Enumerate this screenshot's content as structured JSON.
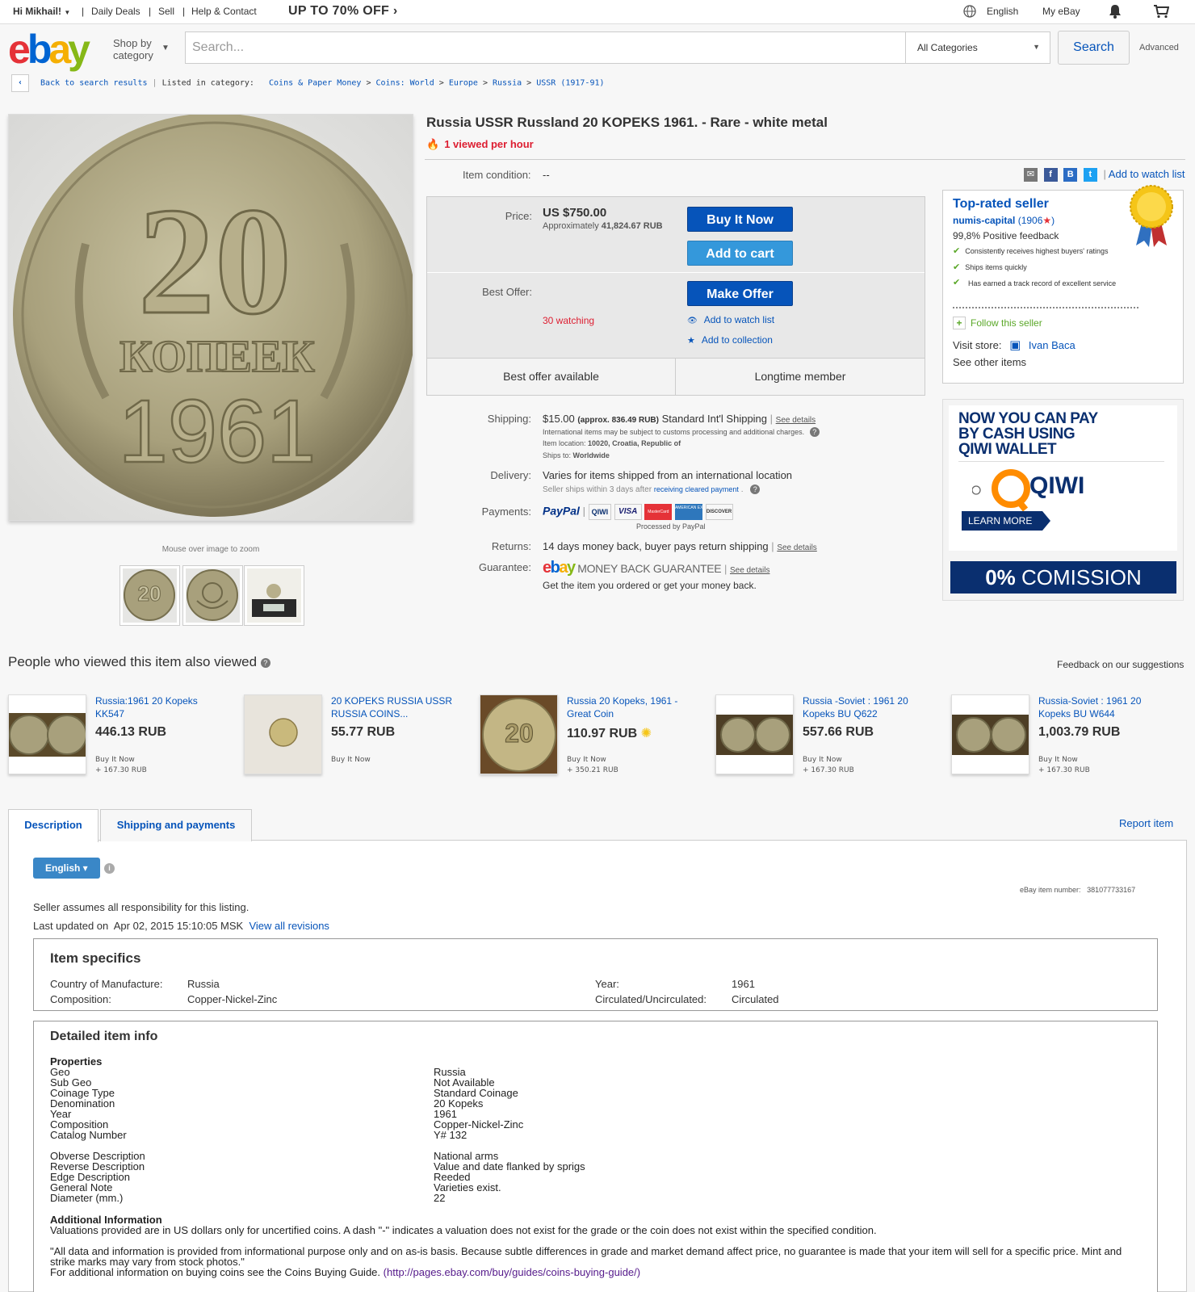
{
  "topbar": {
    "greeting": "Hi Mikhail!",
    "daily_deals": "Daily Deals",
    "sell": "Sell",
    "help": "Help & Contact",
    "promo": "UP TO 70% OFF ›",
    "language": "English",
    "my_ebay": "My eBay"
  },
  "header": {
    "logo": [
      "e",
      "b",
      "a",
      "y"
    ],
    "shop_by_1": "Shop by",
    "shop_by_2": "category",
    "search_placeholder": "Search...",
    "category": "All Categories",
    "search_button": "Search",
    "advanced": "Advanced"
  },
  "breadcrumb": {
    "back": "Back to search results",
    "listed": "Listed in category:",
    "items": [
      "Coins & Paper Money",
      "Coins: World",
      "Europe",
      "Russia",
      "USSR (1917-91)"
    ]
  },
  "gallery": {
    "zoom_note": "Mouse over image to zoom",
    "coin_value": "20",
    "coin_word": "КОПЕЕК",
    "coin_year": "1961"
  },
  "item": {
    "title": "Russia USSR Russland 20 KOPEKS 1961. - Rare - white metal",
    "viewed": "1 viewed per hour",
    "condition_label": "Item condition:",
    "condition_value": "--",
    "add_watch": "Add to watch list",
    "share_b": "B"
  },
  "buybox": {
    "price_label": "Price:",
    "price": "US $750.00",
    "approx_prefix": "Approximately",
    "approx_value": "41,824.67 RUB",
    "buy_now": "Buy It Now",
    "add_to_cart": "Add to cart",
    "best_offer_label": "Best Offer:",
    "make_offer": "Make Offer",
    "watching": "30 watching",
    "add_watch": "Add to watch list",
    "add_collection": "Add to collection",
    "best_offer_available": "Best offer available",
    "longtime_member": "Longtime member"
  },
  "seller": {
    "badge": "Top-rated seller",
    "name": "numis-capital",
    "score": "(1906",
    "score_end": ")",
    "positive": "99,8% Positive feedback",
    "checks": [
      "Consistently receives highest buyers' ratings",
      "Ships items quickly",
      "Has earned a track record of excellent service"
    ],
    "follow": "Follow this seller",
    "visit_store": "Visit store:",
    "store_name": "Ivan Baca",
    "see_other": "See other items"
  },
  "qiwi_ad": {
    "line1": "NOW YOU CAN PAY",
    "line2": "BY CASH USING",
    "line3": "QIWI WALLET",
    "brand": "QIWI",
    "learn_more": "LEARN MORE",
    "commission_pct": "0%",
    "commission_word": "COMISSION"
  },
  "details": {
    "shipping_label": "Shipping:",
    "shipping_price": "$15.00",
    "shipping_approx": "(approx. 836.49 RUB)",
    "shipping_service": "Standard Int'l Shipping",
    "see_details": "See details",
    "intl_note": "International items may be subject to customs processing and additional charges.",
    "item_location_label": "Item location:",
    "item_location": "10020, Croatia, Republic of",
    "ships_to_label": "Ships to:",
    "ships_to": "Worldwide",
    "delivery_label": "Delivery:",
    "delivery": "Varies for items shipped from an international location",
    "delivery_note_1": "Seller ships within 3 days after",
    "delivery_note_link": "receiving cleared payment",
    "payments_label": "Payments:",
    "paypal": "PayPal",
    "processed_by": "Processed by PayPal",
    "card_labels": [
      "QIWI",
      "VISA",
      "MasterCard",
      "AMERICAN EXPRESS",
      "DISCOVER"
    ],
    "returns_label": "Returns:",
    "returns": "14 days money back, buyer pays return shipping",
    "guarantee_label": "Guarantee:",
    "guarantee_text": "MONEY BACK GUARANTEE",
    "guarantee_note": "Get the item you ordered or get your money back."
  },
  "also_viewed": {
    "title": "People who viewed this item also viewed",
    "feedback": "Feedback on our suggestions",
    "cards": [
      {
        "title": "Russia:1961 20 Kopeks KK547",
        "price": "446.13 RUB",
        "bin": "Buy It Now",
        "ship": "+ 167.30 RUB"
      },
      {
        "title": "20 KOPEKS RUSSIA USSR RUSSIA COINS...",
        "price": "55.77 RUB",
        "bin": "Buy It Now",
        "ship": ""
      },
      {
        "title": "Russia 20 Kopeks, 1961 - Great Coin",
        "price": "110.97 RUB",
        "bin": "Buy It Now",
        "ship": "+ 350.21 RUB"
      },
      {
        "title": "Russia -Soviet : 1961 20 Kopeks BU Q622",
        "price": "557.66 RUB",
        "bin": "Buy It Now",
        "ship": "+ 167.30 RUB"
      },
      {
        "title": "Russia-Soviet : 1961 20 Kopeks BU W644",
        "price": "1,003.79 RUB",
        "bin": "Buy It Now",
        "ship": "+ 167.30 RUB"
      }
    ]
  },
  "tabs": {
    "description": "Description",
    "shipping": "Shipping and payments",
    "report": "Report item"
  },
  "description": {
    "language_button": "English ▾",
    "item_number_label": "eBay item number:",
    "item_number": "381077733167",
    "responsibility": "Seller assumes all responsibility for this listing.",
    "last_updated_label": "Last updated on",
    "last_updated": "Apr 02, 2015 15:10:05 MSK",
    "view_revisions": "View all revisions"
  },
  "item_specifics": {
    "title": "Item specifics",
    "rows": [
      {
        "label": "Country of Manufacture:",
        "value": "Russia"
      },
      {
        "label": "Composition:",
        "value": "Copper-Nickel-Zinc"
      },
      {
        "label": "Year:",
        "value": "1961"
      },
      {
        "label": "Circulated/Uncirculated:",
        "value": "Circulated"
      }
    ]
  },
  "detailed_info": {
    "title": "Detailed item info",
    "properties_heading": "Properties",
    "group1": [
      {
        "label": "Geo",
        "value": "Russia"
      },
      {
        "label": "Sub Geo",
        "value": "Not Available"
      },
      {
        "label": "Coinage Type",
        "value": "Standard Coinage"
      },
      {
        "label": "Denomination",
        "value": "20 Kopeks"
      },
      {
        "label": "Year",
        "value": "1961"
      },
      {
        "label": "Composition",
        "value": "Copper-Nickel-Zinc"
      },
      {
        "label": "Catalog Number",
        "value": "Y# 132"
      }
    ],
    "group2": [
      {
        "label": "Obverse Description",
        "value": "National arms"
      },
      {
        "label": "Reverse Description",
        "value": "Value and date flanked by sprigs"
      },
      {
        "label": "Edge Description",
        "value": "Reeded"
      },
      {
        "label": "General Note",
        "value": "Varieties exist."
      },
      {
        "label": "Diameter (mm.)",
        "value": "22"
      }
    ],
    "additional_heading": "Additional Information",
    "valuations": "Valuations provided are in US dollars only for uncertified coins. A dash \"-\" indicates a valuation does not exist for the grade or the coin does not exist within the specified condition.",
    "disclaimer": "\"All data and information is provided from informational purpose only and on as-is basis. Because subtle differences in grade and market demand affect price, no guarantee is made that your item will sell for a specific price. Mint and strike marks may vary from stock photos.\"",
    "guide_prefix": "For additional information on buying coins see the Coins Buying Guide.",
    "guide_link": "(http://pages.ebay.com/buy/guides/coins-buying-guide/)"
  }
}
